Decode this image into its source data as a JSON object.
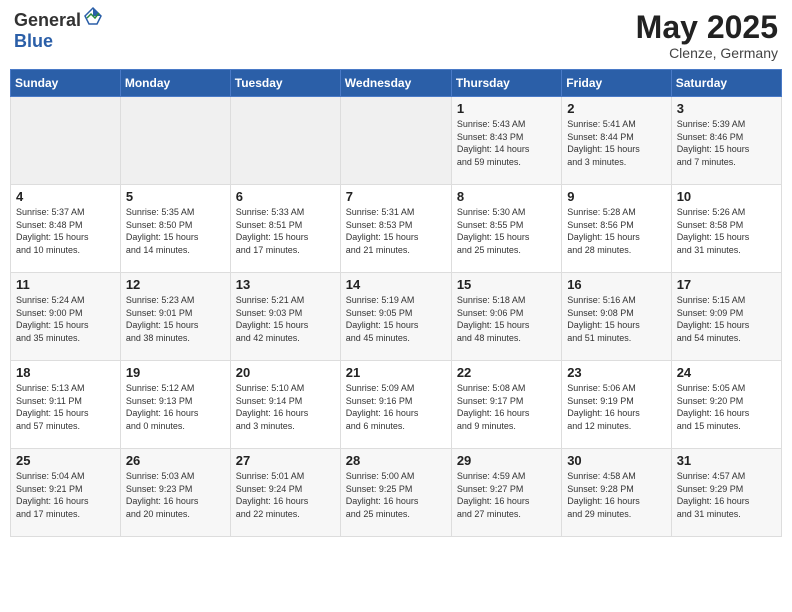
{
  "header": {
    "logo_general": "General",
    "logo_blue": "Blue",
    "month_year": "May 2025",
    "location": "Clenze, Germany"
  },
  "weekdays": [
    "Sunday",
    "Monday",
    "Tuesday",
    "Wednesday",
    "Thursday",
    "Friday",
    "Saturday"
  ],
  "weeks": [
    [
      {
        "day": "",
        "content": ""
      },
      {
        "day": "",
        "content": ""
      },
      {
        "day": "",
        "content": ""
      },
      {
        "day": "",
        "content": ""
      },
      {
        "day": "1",
        "content": "Sunrise: 5:43 AM\nSunset: 8:43 PM\nDaylight: 14 hours\nand 59 minutes."
      },
      {
        "day": "2",
        "content": "Sunrise: 5:41 AM\nSunset: 8:44 PM\nDaylight: 15 hours\nand 3 minutes."
      },
      {
        "day": "3",
        "content": "Sunrise: 5:39 AM\nSunset: 8:46 PM\nDaylight: 15 hours\nand 7 minutes."
      }
    ],
    [
      {
        "day": "4",
        "content": "Sunrise: 5:37 AM\nSunset: 8:48 PM\nDaylight: 15 hours\nand 10 minutes."
      },
      {
        "day": "5",
        "content": "Sunrise: 5:35 AM\nSunset: 8:50 PM\nDaylight: 15 hours\nand 14 minutes."
      },
      {
        "day": "6",
        "content": "Sunrise: 5:33 AM\nSunset: 8:51 PM\nDaylight: 15 hours\nand 17 minutes."
      },
      {
        "day": "7",
        "content": "Sunrise: 5:31 AM\nSunset: 8:53 PM\nDaylight: 15 hours\nand 21 minutes."
      },
      {
        "day": "8",
        "content": "Sunrise: 5:30 AM\nSunset: 8:55 PM\nDaylight: 15 hours\nand 25 minutes."
      },
      {
        "day": "9",
        "content": "Sunrise: 5:28 AM\nSunset: 8:56 PM\nDaylight: 15 hours\nand 28 minutes."
      },
      {
        "day": "10",
        "content": "Sunrise: 5:26 AM\nSunset: 8:58 PM\nDaylight: 15 hours\nand 31 minutes."
      }
    ],
    [
      {
        "day": "11",
        "content": "Sunrise: 5:24 AM\nSunset: 9:00 PM\nDaylight: 15 hours\nand 35 minutes."
      },
      {
        "day": "12",
        "content": "Sunrise: 5:23 AM\nSunset: 9:01 PM\nDaylight: 15 hours\nand 38 minutes."
      },
      {
        "day": "13",
        "content": "Sunrise: 5:21 AM\nSunset: 9:03 PM\nDaylight: 15 hours\nand 42 minutes."
      },
      {
        "day": "14",
        "content": "Sunrise: 5:19 AM\nSunset: 9:05 PM\nDaylight: 15 hours\nand 45 minutes."
      },
      {
        "day": "15",
        "content": "Sunrise: 5:18 AM\nSunset: 9:06 PM\nDaylight: 15 hours\nand 48 minutes."
      },
      {
        "day": "16",
        "content": "Sunrise: 5:16 AM\nSunset: 9:08 PM\nDaylight: 15 hours\nand 51 minutes."
      },
      {
        "day": "17",
        "content": "Sunrise: 5:15 AM\nSunset: 9:09 PM\nDaylight: 15 hours\nand 54 minutes."
      }
    ],
    [
      {
        "day": "18",
        "content": "Sunrise: 5:13 AM\nSunset: 9:11 PM\nDaylight: 15 hours\nand 57 minutes."
      },
      {
        "day": "19",
        "content": "Sunrise: 5:12 AM\nSunset: 9:13 PM\nDaylight: 16 hours\nand 0 minutes."
      },
      {
        "day": "20",
        "content": "Sunrise: 5:10 AM\nSunset: 9:14 PM\nDaylight: 16 hours\nand 3 minutes."
      },
      {
        "day": "21",
        "content": "Sunrise: 5:09 AM\nSunset: 9:16 PM\nDaylight: 16 hours\nand 6 minutes."
      },
      {
        "day": "22",
        "content": "Sunrise: 5:08 AM\nSunset: 9:17 PM\nDaylight: 16 hours\nand 9 minutes."
      },
      {
        "day": "23",
        "content": "Sunrise: 5:06 AM\nSunset: 9:19 PM\nDaylight: 16 hours\nand 12 minutes."
      },
      {
        "day": "24",
        "content": "Sunrise: 5:05 AM\nSunset: 9:20 PM\nDaylight: 16 hours\nand 15 minutes."
      }
    ],
    [
      {
        "day": "25",
        "content": "Sunrise: 5:04 AM\nSunset: 9:21 PM\nDaylight: 16 hours\nand 17 minutes."
      },
      {
        "day": "26",
        "content": "Sunrise: 5:03 AM\nSunset: 9:23 PM\nDaylight: 16 hours\nand 20 minutes."
      },
      {
        "day": "27",
        "content": "Sunrise: 5:01 AM\nSunset: 9:24 PM\nDaylight: 16 hours\nand 22 minutes."
      },
      {
        "day": "28",
        "content": "Sunrise: 5:00 AM\nSunset: 9:25 PM\nDaylight: 16 hours\nand 25 minutes."
      },
      {
        "day": "29",
        "content": "Sunrise: 4:59 AM\nSunset: 9:27 PM\nDaylight: 16 hours\nand 27 minutes."
      },
      {
        "day": "30",
        "content": "Sunrise: 4:58 AM\nSunset: 9:28 PM\nDaylight: 16 hours\nand 29 minutes."
      },
      {
        "day": "31",
        "content": "Sunrise: 4:57 AM\nSunset: 9:29 PM\nDaylight: 16 hours\nand 31 minutes."
      }
    ]
  ]
}
